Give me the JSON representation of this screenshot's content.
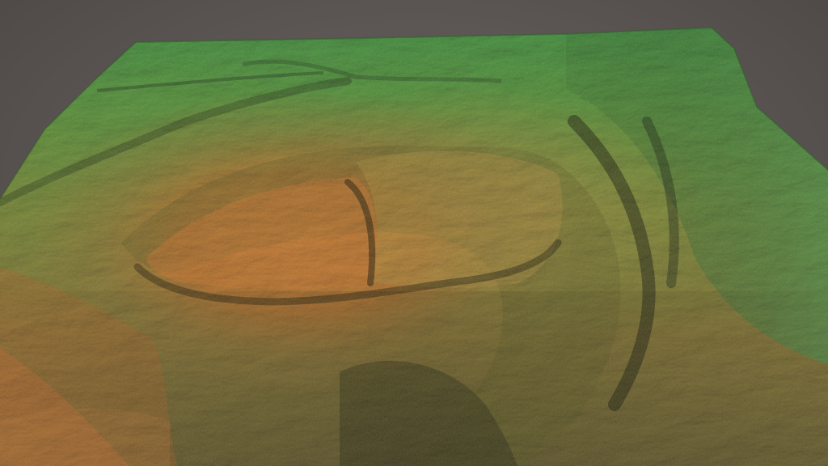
{
  "scene": {
    "subject": "terrain-relief-model",
    "background_color": "#5f5a57",
    "palette": {
      "low_green": "#3f8f45",
      "mid_green": "#6c9f3c",
      "olive": "#7d8a34",
      "yellow": "#a99a45",
      "orange": "#c97a35",
      "deep_orange": "#b76428",
      "shadow": "#1f2414"
    }
  }
}
